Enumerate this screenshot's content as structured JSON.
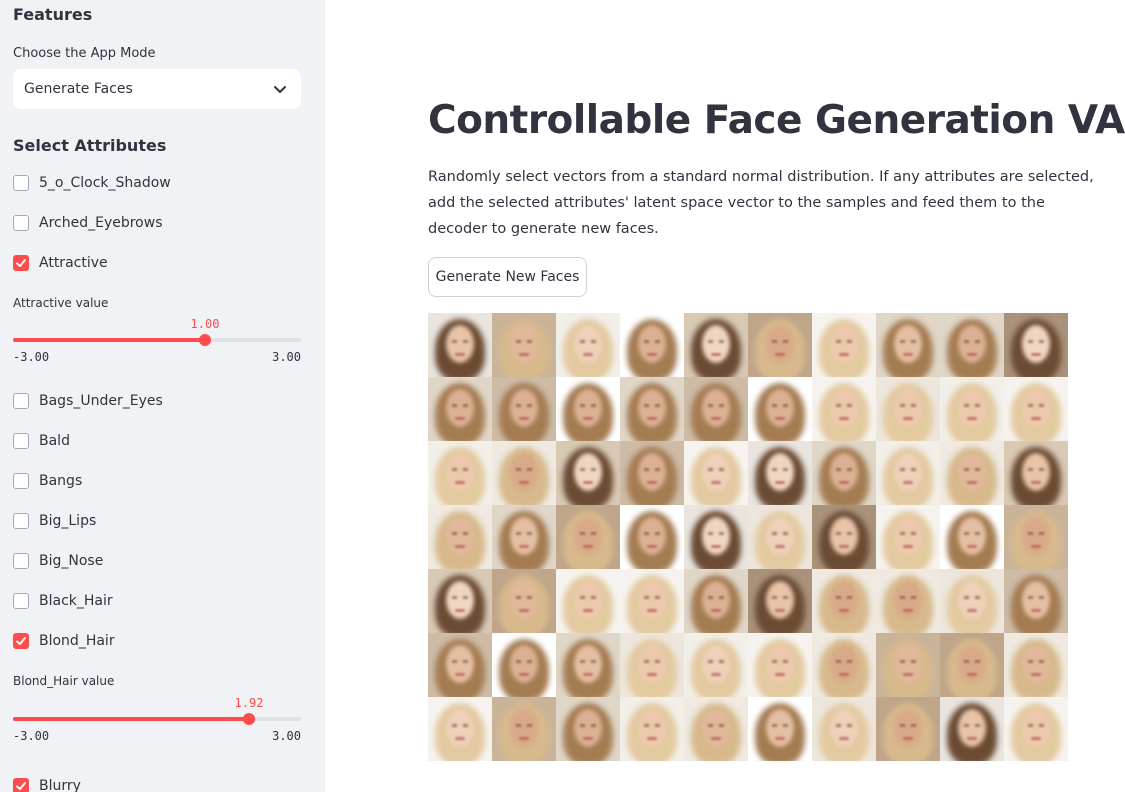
{
  "sidebar": {
    "features_title": "Features",
    "mode_label": "Choose the App Mode",
    "mode_selected": "Generate Faces",
    "attributes_heading": "Select Attributes",
    "attributes": [
      {
        "label": "5_o_Clock_Shadow",
        "checked": false
      },
      {
        "label": "Arched_Eyebrows",
        "checked": false
      },
      {
        "label": "Attractive",
        "checked": true
      },
      {
        "label": "Bags_Under_Eyes",
        "checked": false
      },
      {
        "label": "Bald",
        "checked": false
      },
      {
        "label": "Bangs",
        "checked": false
      },
      {
        "label": "Big_Lips",
        "checked": false
      },
      {
        "label": "Big_Nose",
        "checked": false
      },
      {
        "label": "Black_Hair",
        "checked": false
      },
      {
        "label": "Blond_Hair",
        "checked": true
      },
      {
        "label": "Blurry",
        "checked": true
      }
    ],
    "sliders": [
      {
        "label": "Attractive value",
        "value": "1.00",
        "value_num": 1.0,
        "min": "-3.00",
        "max": "3.00",
        "min_num": -3.0,
        "max_num": 3.0
      },
      {
        "label": "Blond_Hair value",
        "value": "1.92",
        "value_num": 1.92,
        "min": "-3.00",
        "max": "3.00",
        "min_num": -3.0,
        "max_num": 3.0
      }
    ]
  },
  "main": {
    "title": "Controllable Face Generation VAE",
    "description": "Randomly select vectors from a standard normal distribution. If any attributes are selected, add the selected attributes' latent space vector to the samples and feed them to the decoder to generate new faces.",
    "generate_button": "Generate New Faces",
    "grid_columns": 10,
    "grid_rows": 7
  },
  "colors": {
    "accent": "#ff4b4b",
    "sidebar_bg": "#f0f2f6",
    "text": "#31333f"
  }
}
